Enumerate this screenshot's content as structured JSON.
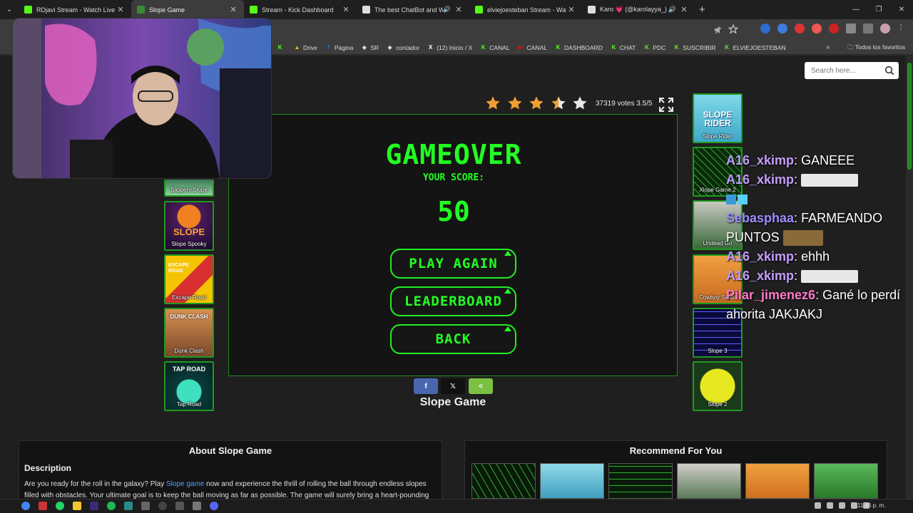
{
  "browser": {
    "tabs": [
      {
        "title": "RDjavi Stream - Watch Live on K",
        "favicon": "kick-icon",
        "color": "#53fc18",
        "active": false,
        "audio": false
      },
      {
        "title": "Slope Game",
        "favicon": "slope-icon",
        "color": "#3a8a3a",
        "active": true,
        "audio": false
      },
      {
        "title": "Stream - Kick Dashboard",
        "favicon": "kick-icon",
        "color": "#53fc18",
        "active": false,
        "audio": false
      },
      {
        "title": "The best ChatBot and Widg",
        "favicon": "botrix-icon",
        "color": "#dddddd",
        "active": false,
        "audio": true
      },
      {
        "title": "elviejoesteban Stream - Watch",
        "favicon": "kick-icon",
        "color": "#53fc18",
        "active": false,
        "audio": false
      },
      {
        "title": "Karo 💗 (@karolayya_) está",
        "favicon": "tiktok-icon",
        "color": "#dddddd",
        "active": false,
        "audio": true
      }
    ],
    "bookmarks": [
      {
        "label": "",
        "icon": "kick-icon",
        "color": "#53fc18"
      },
      {
        "label": "Drive",
        "icon": "drive-icon",
        "color": "#f4c20d"
      },
      {
        "label": "Página",
        "icon": "facebook-icon",
        "color": "#1877f2"
      },
      {
        "label": "SR",
        "icon": "botrix-icon",
        "color": "#dddddd"
      },
      {
        "label": "contador",
        "icon": "botrix-icon",
        "color": "#dddddd"
      },
      {
        "label": "(12) Inicio / X",
        "icon": "x-icon",
        "color": "#ffffff"
      },
      {
        "label": "CANAL",
        "icon": "kick-icon",
        "color": "#53fc18"
      },
      {
        "label": "CANAL",
        "icon": "youtube-icon",
        "color": "#ff0000"
      },
      {
        "label": "DASHBOARD",
        "icon": "kick-icon",
        "color": "#53fc18"
      },
      {
        "label": "CHAT",
        "icon": "kick-icon",
        "color": "#53fc18"
      },
      {
        "label": "PDC",
        "icon": "kick-icon",
        "color": "#53fc18"
      },
      {
        "label": "SUSCRIBIR",
        "icon": "kick-icon",
        "color": "#53fc18"
      },
      {
        "label": "ELVIEJOESTEBAN",
        "icon": "kick-icon",
        "color": "#53fc18"
      }
    ],
    "all_bookmarks": "Todos los favoritos"
  },
  "search": {
    "placeholder": "Search here..."
  },
  "rating": {
    "stars_filled": 3.5,
    "stars_total": 5,
    "text": "37319 votes 3.5/5"
  },
  "game": {
    "title": "GAMEOVER",
    "subtitle": "YOUR SCORE:",
    "score": "50",
    "buttons": {
      "play_again": "PLAY AGAIN",
      "leaderboard": "LEADERBOARD",
      "back": "BACK"
    },
    "accent": "#22ff22"
  },
  "share": {
    "facebook": "f",
    "x": "𝕏",
    "share": "<"
  },
  "game_name": "Slope Game",
  "left_thumbs": [
    {
      "caption": "Slippery Slope"
    },
    {
      "caption": "Slope Spooky",
      "overlay": "SLOPE"
    },
    {
      "caption": "Escape Road",
      "overlay": "ESCAPE ROAD"
    },
    {
      "caption": "Dunk Clash",
      "overlay": "DUNK CLASH"
    },
    {
      "caption": "Tap Road",
      "overlay": "TAP ROAD"
    }
  ],
  "right_thumbs": [
    {
      "caption": "Slope Rider",
      "overlay": "SLOPE RIDER"
    },
    {
      "caption": "Xlope Game 2"
    },
    {
      "caption": "Undead Go"
    },
    {
      "caption": "Cowboy Safari"
    },
    {
      "caption": "Slope 3"
    },
    {
      "caption": "Slope 2"
    }
  ],
  "about": {
    "title": "About Slope Game",
    "heading": "Description",
    "text_before": "Are you ready for the roll in the galaxy? Play ",
    "link": "Slope game",
    "text_after": " now and experience the thrill of rolling the ball through endless slopes filled with obstacles. Your ultimate goal is to keep the ball moving as far as possible. The game will surely bring a heart-pounding"
  },
  "recommend": {
    "title": "Recommend For You"
  },
  "chat": [
    {
      "user": "A16_xkimp",
      "sep": ": ",
      "text": "GANEEE",
      "color": "#c49cff"
    },
    {
      "user": "A16_xkimp",
      "sep": ": ",
      "text": "",
      "emote": true,
      "color": "#c49cff"
    },
    {
      "user": "",
      "sep": "",
      "text": "",
      "badges": true,
      "color": "#ffffff"
    },
    {
      "user": "Sebasphaa",
      "sep": ": ",
      "text": "FARMEANDO PUNTOS",
      "emote2": true,
      "color": "#9f8cff"
    },
    {
      "user": "A16_xkimp",
      "sep": ": ",
      "text": "ehhh",
      "color": "#c49cff"
    },
    {
      "user": "A16_xkimp",
      "sep": ": ",
      "text": "",
      "emote": true,
      "color": "#c49cff"
    },
    {
      "user": "Pilar_jimenez6",
      "sep": ": ",
      "text": "Gané lo perdí ahorita JAKJAKJ",
      "color": "#ff7ac8"
    }
  ],
  "taskbar": {
    "clock": "11:46 p. m."
  }
}
